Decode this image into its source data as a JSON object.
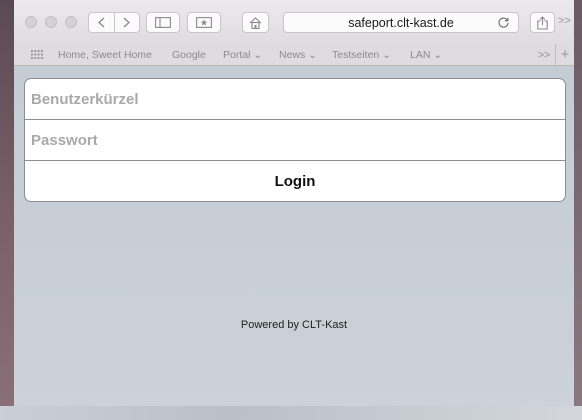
{
  "browser": {
    "address": "safeport.clt-kast.de",
    "more_tabs": ">>",
    "bookmarks": [
      {
        "label": "Home, Sweet Home"
      },
      {
        "label": "Google"
      },
      {
        "label": "Portal ⌄"
      },
      {
        "label": "News ⌄"
      },
      {
        "label": "Testseiten ⌄"
      },
      {
        "label": "LAN ⌄"
      }
    ],
    "bookmarks_more": ">>",
    "new_tab": "+"
  },
  "login": {
    "username_placeholder": "Benutzerkürzel",
    "password_placeholder": "Passwort",
    "button_label": "Login"
  },
  "footer": {
    "text": "Powered by CLT-Kast"
  },
  "colors": {
    "card_border": "#8a8e94",
    "page_bg": "#c8cfd7",
    "toolbar_bg": "#e6e4e6"
  }
}
